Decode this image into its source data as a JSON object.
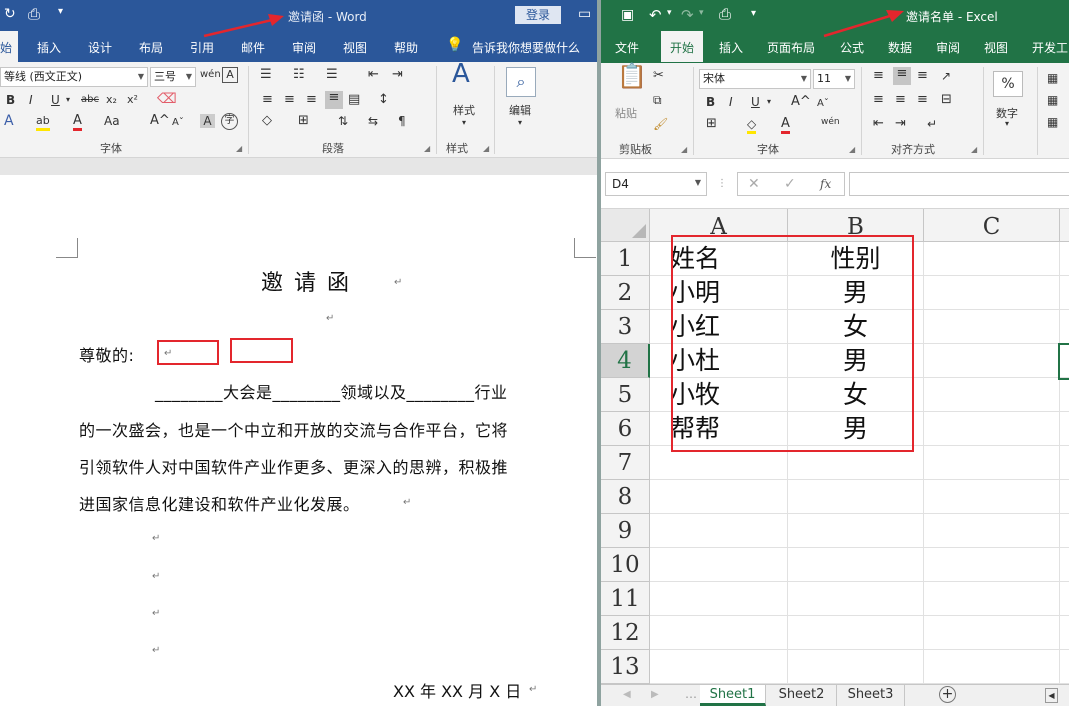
{
  "word": {
    "title": "邀请函 - Word",
    "login_label": "登录",
    "tabs": [
      "始",
      "插入",
      "设计",
      "布局",
      "引用",
      "邮件",
      "审阅",
      "视图",
      "帮助"
    ],
    "tell_me": "告诉我你想要做什么",
    "font_name": "等线 (西文正文)",
    "font_size": "三号",
    "groups": {
      "font": "字体",
      "paragraph": "段落",
      "styles": "样式"
    },
    "styles_label": "样式",
    "edit_label": "编辑",
    "document": {
      "heading": "邀  请  函",
      "salutation": "尊敬的:",
      "line1": "________大会是________领域以及________行业",
      "line2": "的一次盛会，也是一个中立和开放的交流与合作平台，它将",
      "line3": "引领软件人对中国软件产业作更多、更深入的思辨，积极推",
      "line4": "进国家信息化建设和软件产业化发展。",
      "date": "XX 年 XX 月 X 日"
    }
  },
  "excel": {
    "title": "邀请名单 - Excel",
    "tabs": [
      "文件",
      "开始",
      "插入",
      "页面布局",
      "公式",
      "数据",
      "审阅",
      "视图",
      "开发工"
    ],
    "paste_label": "粘贴",
    "font_name": "宋体",
    "font_size": "11",
    "number_label": "数字",
    "number_icon": "%",
    "groups": {
      "clipboard": "剪贴板",
      "font": "字体",
      "alignment": "对齐方式"
    },
    "wen_label": "wén",
    "name_box": "D4",
    "fx_label": "fx",
    "columns": [
      "A",
      "B",
      "C"
    ],
    "row_numbers": [
      "1",
      "2",
      "3",
      "4",
      "5",
      "6",
      "7",
      "8",
      "9",
      "10",
      "11",
      "12",
      "13"
    ],
    "rows": [
      [
        "姓名",
        "性别"
      ],
      [
        "小明",
        "男"
      ],
      [
        "小红",
        "女"
      ],
      [
        "小杜",
        "男"
      ],
      [
        "小牧",
        "女"
      ],
      [
        "帮帮",
        "男"
      ]
    ],
    "sheets": [
      "Sheet1",
      "Sheet2",
      "Sheet3"
    ],
    "active_sheet": "Sheet1",
    "selected_cell": "D4"
  },
  "colors": {
    "word_brand": "#2b579a",
    "excel_brand": "#217346",
    "highlight_red": "#e3262d"
  }
}
